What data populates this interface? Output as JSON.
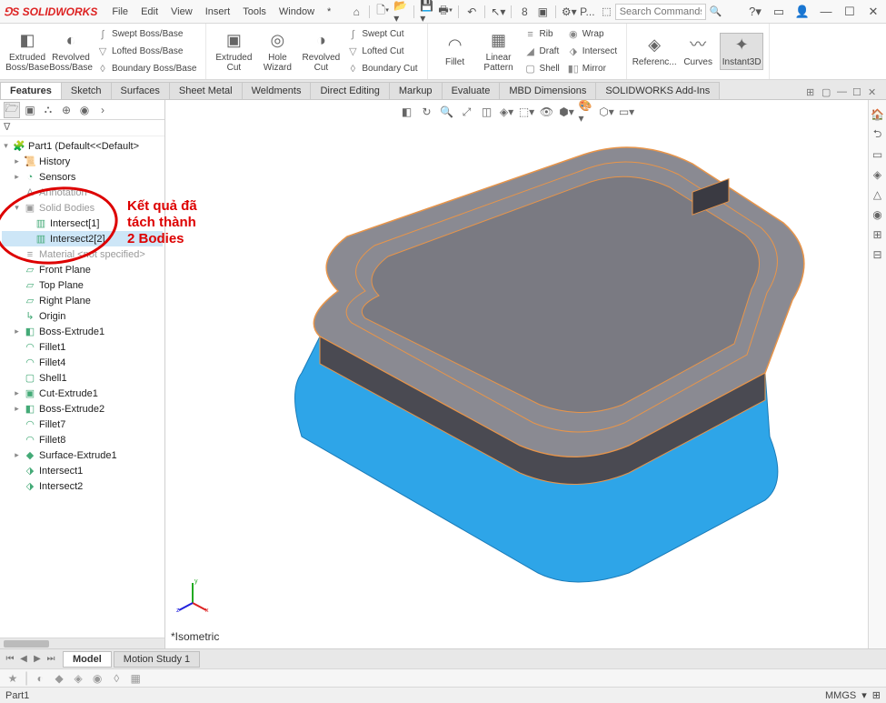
{
  "app": {
    "name": "SOLIDWORKS"
  },
  "menus": [
    "File",
    "Edit",
    "View",
    "Insert",
    "Tools",
    "Window",
    "*"
  ],
  "search": {
    "placeholder": "Search Commands"
  },
  "qat_icons": [
    "home",
    "new",
    "open",
    "save",
    "print",
    "undo",
    "redo",
    "select",
    "settings",
    "8",
    "options",
    "p"
  ],
  "title_right": [
    "help",
    "bell",
    "user",
    "minimize",
    "maximize",
    "close"
  ],
  "ribbon": {
    "bigbtns": [
      {
        "label": "Extruded Boss/Base",
        "icon": "◧"
      },
      {
        "label": "Revolved Boss/Base",
        "icon": "◐"
      }
    ],
    "bosscol": [
      "Swept Boss/Base",
      "Lofted Boss/Base",
      "Boundary Boss/Base"
    ],
    "cutbig": [
      {
        "label": "Extruded Cut",
        "icon": "▣"
      },
      {
        "label": "Hole Wizard",
        "icon": "◎"
      },
      {
        "label": "Revolved Cut",
        "icon": "◑"
      }
    ],
    "cutcol": [
      "Swept Cut",
      "Lofted Cut",
      "Boundary Cut"
    ],
    "opsbig": [
      {
        "label": "Fillet",
        "icon": "◠"
      },
      {
        "label": "Linear Pattern",
        "icon": "▦"
      }
    ],
    "opscol": [
      "Rib",
      "Draft",
      "Shell"
    ],
    "opscol2": [
      "Wrap",
      "Intersect",
      "Mirror"
    ],
    "refbig": [
      {
        "label": "Referenc...",
        "icon": "◈"
      },
      {
        "label": "Curves",
        "icon": "〰"
      },
      {
        "label": "Instant3D",
        "icon": "✦",
        "active": true
      }
    ]
  },
  "tabs": [
    "Features",
    "Sketch",
    "Surfaces",
    "Sheet Metal",
    "Weldments",
    "Direct Editing",
    "Markup",
    "Evaluate",
    "MBD Dimensions",
    "SOLIDWORKS Add-Ins"
  ],
  "active_tab": "Features",
  "tree": {
    "root": "Part1 (Default<<Default>",
    "items": [
      {
        "label": "History",
        "icon": "📜",
        "exp": "▸",
        "indent": 1
      },
      {
        "label": "Sensors",
        "icon": "◔",
        "exp": "▸",
        "indent": 1
      },
      {
        "label": "Annotation",
        "icon": "A",
        "exp": "",
        "indent": 1,
        "dim": true
      },
      {
        "label": "Solid Bodies",
        "icon": "▣",
        "exp": "▾",
        "indent": 1,
        "dim": true
      },
      {
        "label": "Intersect[1]",
        "icon": "▥",
        "exp": "",
        "indent": 2,
        "sel": false
      },
      {
        "label": "Intersect2[2]",
        "icon": "▥",
        "exp": "",
        "indent": 2,
        "sel": true
      },
      {
        "label": "Material <not specified>",
        "icon": "≡",
        "exp": "",
        "indent": 1,
        "dim": true
      },
      {
        "label": "Front Plane",
        "icon": "▱",
        "exp": "",
        "indent": 1
      },
      {
        "label": "Top Plane",
        "icon": "▱",
        "exp": "",
        "indent": 1
      },
      {
        "label": "Right Plane",
        "icon": "▱",
        "exp": "",
        "indent": 1
      },
      {
        "label": "Origin",
        "icon": "↳",
        "exp": "",
        "indent": 1
      },
      {
        "label": "Boss-Extrude1",
        "icon": "◧",
        "exp": "▸",
        "indent": 1
      },
      {
        "label": "Fillet1",
        "icon": "◠",
        "exp": "",
        "indent": 1
      },
      {
        "label": "Fillet4",
        "icon": "◠",
        "exp": "",
        "indent": 1
      },
      {
        "label": "Shell1",
        "icon": "▢",
        "exp": "",
        "indent": 1
      },
      {
        "label": "Cut-Extrude1",
        "icon": "▣",
        "exp": "▸",
        "indent": 1
      },
      {
        "label": "Boss-Extrude2",
        "icon": "◧",
        "exp": "▸",
        "indent": 1
      },
      {
        "label": "Fillet7",
        "icon": "◠",
        "exp": "",
        "indent": 1
      },
      {
        "label": "Fillet8",
        "icon": "◠",
        "exp": "",
        "indent": 1
      },
      {
        "label": "Surface-Extrude1",
        "icon": "◆",
        "exp": "▸",
        "indent": 1
      },
      {
        "label": "Intersect1",
        "icon": "⬗",
        "exp": "",
        "indent": 1
      },
      {
        "label": "Intersect2",
        "icon": "⬗",
        "exp": "",
        "indent": 1
      }
    ]
  },
  "view_toolbar": [
    "◧",
    "↻",
    "🔍",
    "⤢",
    "◫",
    "◈",
    "⬚",
    "👁",
    "⬢",
    "•",
    "🎨",
    "⬡",
    "•",
    "▭",
    "▾"
  ],
  "rightbar": [
    "🏠",
    "⮌",
    "▭",
    "◈",
    "△",
    "◉",
    "⊞",
    "⊟"
  ],
  "view_label": "*Isometric",
  "bottom_tabs": [
    "Model",
    "Motion Study 1"
  ],
  "active_bottom_tab": "Model",
  "bottom_toolbar": [
    "★",
    "|",
    "◐",
    "◆",
    "◈",
    "◉",
    "◊",
    "•",
    "▦"
  ],
  "status": {
    "left": "Part1",
    "right": [
      "MMGS",
      "▾",
      "⊞"
    ]
  },
  "annotation": {
    "line1": "Kết quả đã",
    "line2": "tách thành",
    "line3": "2 Bodies"
  }
}
